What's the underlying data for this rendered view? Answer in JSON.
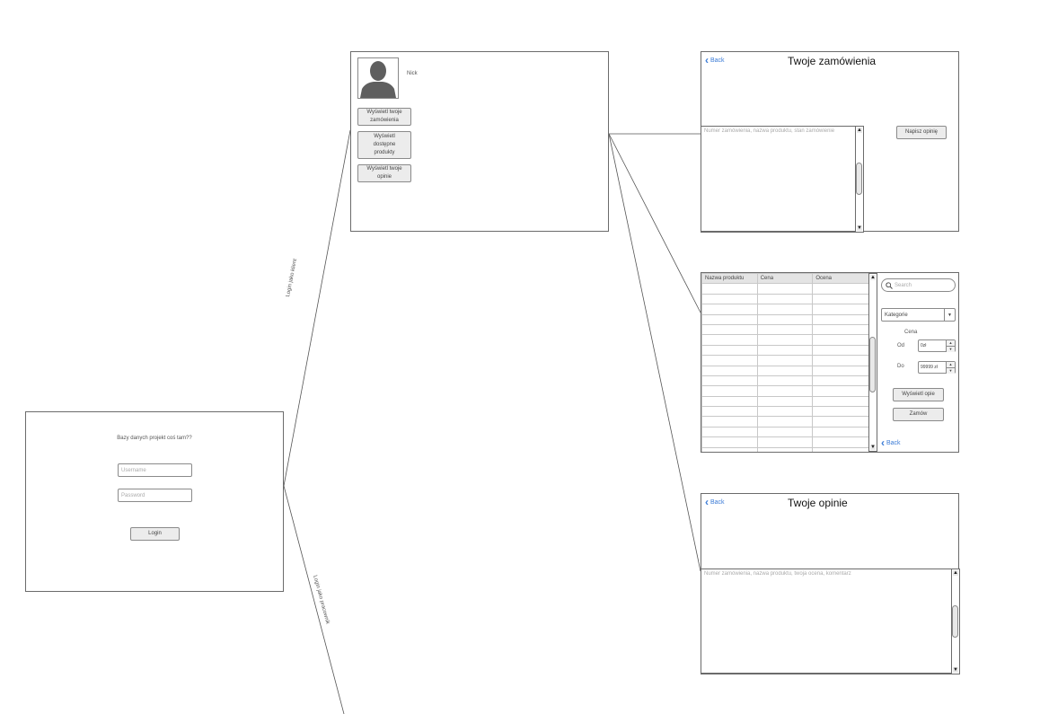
{
  "connectors": {
    "client_label": "Login jako klient",
    "employee_label": "Login jako pracownik"
  },
  "login_screen": {
    "title": "Bazy danych projekt coś tam??",
    "username_placeholder": "Username",
    "password_placeholder": "Password",
    "login_label": "Login"
  },
  "client_menu": {
    "nick": "Nick",
    "btn_orders": "Wyświetl twoje zamówienia",
    "btn_products": "Wyświetl dostępne produkty",
    "btn_reviews": "Wyświetl twoje opinie"
  },
  "orders_screen": {
    "back": "Back",
    "title": "Twoje zamówienia",
    "list_placeholder": "Numer zamówienia, nazwa produktu, stan zamówienie",
    "review_button": "Napisz opinię"
  },
  "products_screen": {
    "columns": [
      "Nazwa produktu",
      "Cena",
      "Ocena"
    ],
    "search_placeholder": "Search",
    "category_select": "Kategorie",
    "price_label": "Cena",
    "from_label": "Od",
    "from_value": "0zł",
    "to_label": "Do",
    "to_value": "99999 zł",
    "show_reviews_button": "Wyświetl opie",
    "order_button": "Zamów",
    "back": "Back"
  },
  "reviews_screen": {
    "back": "Back",
    "title": "Twoje opinie",
    "list_placeholder": "Numer zamówienia, nazwa produktu, twoja ocena, komentarz"
  }
}
